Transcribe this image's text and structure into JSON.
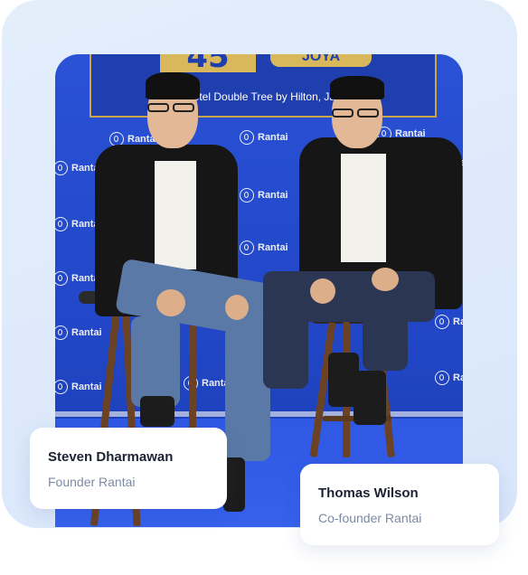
{
  "banner": {
    "number": "45",
    "word": "JOYA",
    "venue": "Hotel Double Tree by Hilton, Jak"
  },
  "watermark": {
    "brand": "Rantai",
    "icon": "rantai-logo-icon"
  },
  "people": [
    {
      "name": "Steven Dharmawan",
      "role": "Founder Rantai"
    },
    {
      "name": "Thomas Wilson",
      "role": "Co-founder Rantai"
    }
  ],
  "colors": {
    "backdrop": "#2247c8",
    "card_bg": "#e0ebfb",
    "name_text": "#1c2233",
    "role_text": "#7d8aa3"
  }
}
